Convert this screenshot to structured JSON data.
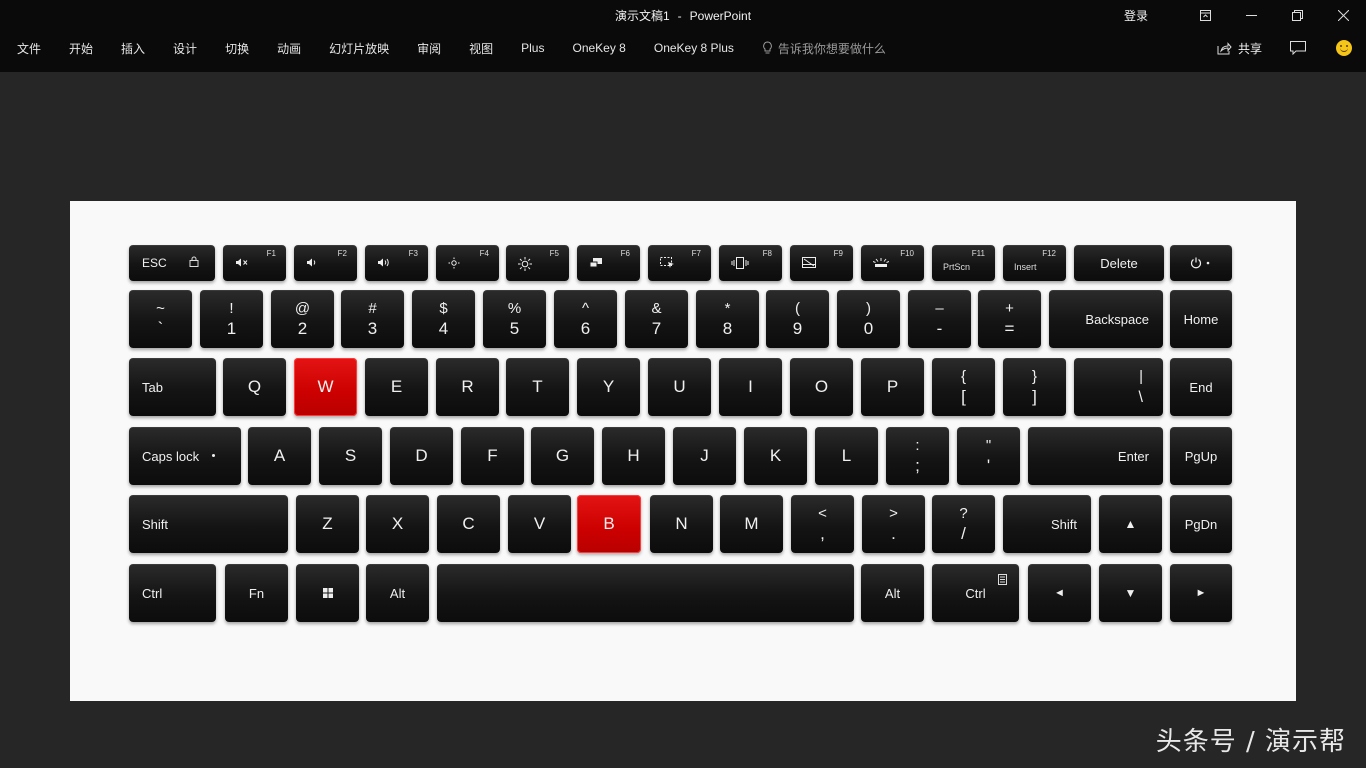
{
  "titlebar": {
    "doc_name": "演示文稿1",
    "separator": "-",
    "app_name": "PowerPoint",
    "login_label": "登录",
    "buttons": [
      "ribbon-display-options-icon",
      "minimize-icon",
      "restore-icon",
      "close-icon"
    ]
  },
  "ribbon": {
    "tabs": [
      "文件",
      "开始",
      "插入",
      "设计",
      "切换",
      "动画",
      "幻灯片放映",
      "审阅",
      "视图",
      "Plus",
      "OneKey 8",
      "OneKey 8 Plus"
    ],
    "tell_me_placeholder": "告诉我你想要做什么",
    "share_label": "共享"
  },
  "keyboard": {
    "highlight_color": "#d40000",
    "highlighted_keys": [
      "W",
      "B"
    ],
    "row_fn": [
      {
        "label": "ESC",
        "icon": "lock-icon"
      },
      {
        "fn": "F1",
        "icon": "mute-icon"
      },
      {
        "fn": "F2",
        "icon": "volume-down-icon"
      },
      {
        "fn": "F3",
        "icon": "volume-up-icon"
      },
      {
        "fn": "F4",
        "icon": "brightness-down-icon"
      },
      {
        "fn": "F5",
        "icon": "brightness-up-icon"
      },
      {
        "fn": "F6",
        "icon": "projection-icon"
      },
      {
        "fn": "F7",
        "icon": "screen-share-icon"
      },
      {
        "fn": "F8",
        "icon": "vibrate-icon"
      },
      {
        "fn": "F9",
        "icon": "touchpad-off-icon"
      },
      {
        "fn": "F10",
        "icon": "keyboard-backlight-icon"
      },
      {
        "fn": "F11",
        "label": "PrtScn"
      },
      {
        "fn": "F12",
        "label": "Insert"
      },
      {
        "label": "Delete"
      },
      {
        "icon": "power-icon"
      }
    ],
    "row_num": [
      {
        "top": "~",
        "bot": "`"
      },
      {
        "top": "!",
        "bot": "1"
      },
      {
        "top": "@",
        "bot": "2"
      },
      {
        "top": "#",
        "bot": "3"
      },
      {
        "top": "$",
        "bot": "4"
      },
      {
        "top": "%",
        "bot": "5"
      },
      {
        "top": "^",
        "bot": "6"
      },
      {
        "top": "&",
        "bot": "7"
      },
      {
        "top": "*",
        "bot": "8"
      },
      {
        "top": "(",
        "bot": "9"
      },
      {
        "top": ")",
        "bot": "0"
      },
      {
        "top": "–",
        "bot": "-"
      },
      {
        "top": "+",
        "bot": "="
      },
      {
        "label": "Backspace"
      },
      {
        "label": "Home"
      }
    ],
    "row_q": [
      {
        "label": "Tab"
      },
      {
        "label": "Q"
      },
      {
        "label": "W"
      },
      {
        "label": "E"
      },
      {
        "label": "R"
      },
      {
        "label": "T"
      },
      {
        "label": "Y"
      },
      {
        "label": "U"
      },
      {
        "label": "I"
      },
      {
        "label": "O"
      },
      {
        "label": "P"
      },
      {
        "top": "{",
        "bot": "["
      },
      {
        "top": "}",
        "bot": "]"
      },
      {
        "top": "|",
        "bot": "\\"
      },
      {
        "label": "End"
      }
    ],
    "row_a": [
      {
        "label": "Caps lock"
      },
      {
        "label": "A"
      },
      {
        "label": "S"
      },
      {
        "label": "D"
      },
      {
        "label": "F"
      },
      {
        "label": "G"
      },
      {
        "label": "H"
      },
      {
        "label": "J"
      },
      {
        "label": "K"
      },
      {
        "label": "L"
      },
      {
        "top": ":",
        "bot": ";"
      },
      {
        "top": "\"",
        "bot": "'"
      },
      {
        "label": "Enter"
      },
      {
        "label": "PgUp"
      }
    ],
    "row_z": [
      {
        "label": "Shift"
      },
      {
        "label": "Z"
      },
      {
        "label": "X"
      },
      {
        "label": "C"
      },
      {
        "label": "V"
      },
      {
        "label": "B"
      },
      {
        "label": "N"
      },
      {
        "label": "M"
      },
      {
        "top": "<",
        "bot": ","
      },
      {
        "top": ">",
        "bot": "."
      },
      {
        "top": "?",
        "bot": "/"
      },
      {
        "label": "Shift"
      },
      {
        "label": "▲"
      },
      {
        "label": "PgDn"
      }
    ],
    "row_bottom": [
      {
        "label": "Ctrl"
      },
      {
        "label": "Fn"
      },
      {
        "icon": "windows-icon"
      },
      {
        "label": "Alt"
      },
      {
        "label": ""
      },
      {
        "label": "Alt"
      },
      {
        "label": "Ctrl",
        "icon": "menu-icon"
      },
      {
        "label": "◄"
      },
      {
        "label": "▼"
      },
      {
        "label": "►"
      }
    ]
  },
  "watermark": "头条号 / 演示帮"
}
